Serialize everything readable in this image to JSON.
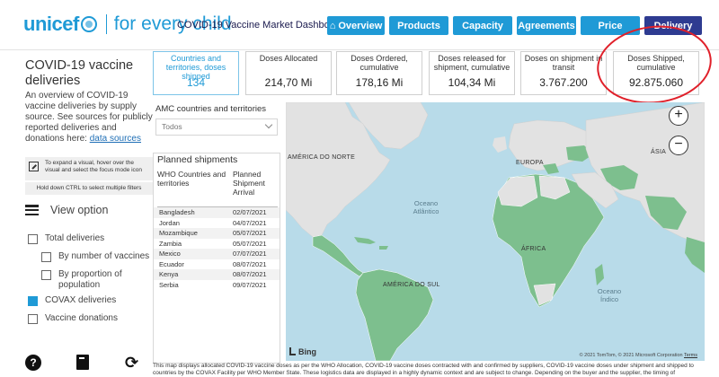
{
  "header": {
    "brand": "unicef",
    "tagline": "for every child",
    "title": "COVID-19 Vaccine Market Dashboard",
    "nav": [
      {
        "label": "Overview",
        "home": true
      },
      {
        "label": "Products"
      },
      {
        "label": "Capacity"
      },
      {
        "label": "Agreements"
      },
      {
        "label": "Price"
      },
      {
        "label": "Delivery",
        "active": true
      }
    ]
  },
  "sidebar": {
    "title": "COVID-19 vaccine deliveries",
    "description": "An overview of COVID-19 vaccine deliveries by supply source. See sources for publicly reported deliveries and donations here:",
    "link_text": "data sources",
    "tip_focus": "To expand a visual, hover over the visual and select the focus mode icon",
    "tip_focus_bold": "focus mode",
    "tip_ctrl": "Hold down CTRL to select multiple filters",
    "view_option": "View option",
    "options": [
      {
        "label": "Total deliveries",
        "checked": false
      },
      {
        "label": "By number of vaccines",
        "checked": false
      },
      {
        "label": "By proportion of population",
        "checked": false
      },
      {
        "label": "COVAX deliveries",
        "checked": true
      },
      {
        "label": "Vaccine donations",
        "checked": false
      }
    ]
  },
  "kpis": [
    {
      "label": "Countries and territories, doses shipped",
      "value": "134",
      "highlight": true
    },
    {
      "label": "Doses Allocated",
      "value": "214,70 Mi"
    },
    {
      "label": "Doses Ordered, cumulative",
      "value": "178,16 Mi"
    },
    {
      "label": "Doses released for shipment, cumulative",
      "value": "104,34 Mi"
    },
    {
      "label": "Doses on shipment in transit",
      "value": "3.767.200"
    },
    {
      "label": "Doses Shipped, cumulative",
      "value": "92.875.060"
    }
  ],
  "filter": {
    "title": "AMC countries and territories",
    "value": "Todos"
  },
  "shipments": {
    "title": "Planned shipments",
    "col1": "WHO Countries and territories",
    "col2": "Planned Shipment Arrival",
    "rows": [
      {
        "country": "Bangladesh",
        "date": "02/07/2021"
      },
      {
        "country": "Jordan",
        "date": "04/07/2021"
      },
      {
        "country": "Mozambique",
        "date": "05/07/2021"
      },
      {
        "country": "Zambia",
        "date": "05/07/2021"
      },
      {
        "country": "Mexico",
        "date": "07/07/2021"
      },
      {
        "country": "Ecuador",
        "date": "08/07/2021"
      },
      {
        "country": "Kenya",
        "date": "08/07/2021"
      },
      {
        "country": "Serbia",
        "date": "09/07/2021"
      }
    ]
  },
  "map": {
    "labels": {
      "north_america": "AMÉRICA DO NORTE",
      "europe": "EUROPA",
      "asia": "ÁSIA",
      "africa": "ÁFRICA",
      "south_america": "AMÉRICA DO SUL",
      "atlantic": "Oceano Atlântico",
      "indian": "Oceano Índico"
    },
    "attribution": "Bing",
    "copyright": "© 2021 TomTom, © 2021 Microsoft Corporation",
    "terms": "Terms",
    "colors": {
      "water": "#b8dbe9",
      "land": "#e2e2e2",
      "highlight": "#7dbf8e"
    }
  },
  "footnote": "This map displays allocated COVID-19 vaccine doses as per the WHO Allocation, COVID-19 vaccine doses contracted with and confirmed by suppliers, COVID-19 vaccine doses under shipment and shipped to countries by the COVAX Facility per WHO Member State. These logistics data are displayed in a highly dynamic context and are subject to change. Depending on the buyer and the supplier, the timing of"
}
